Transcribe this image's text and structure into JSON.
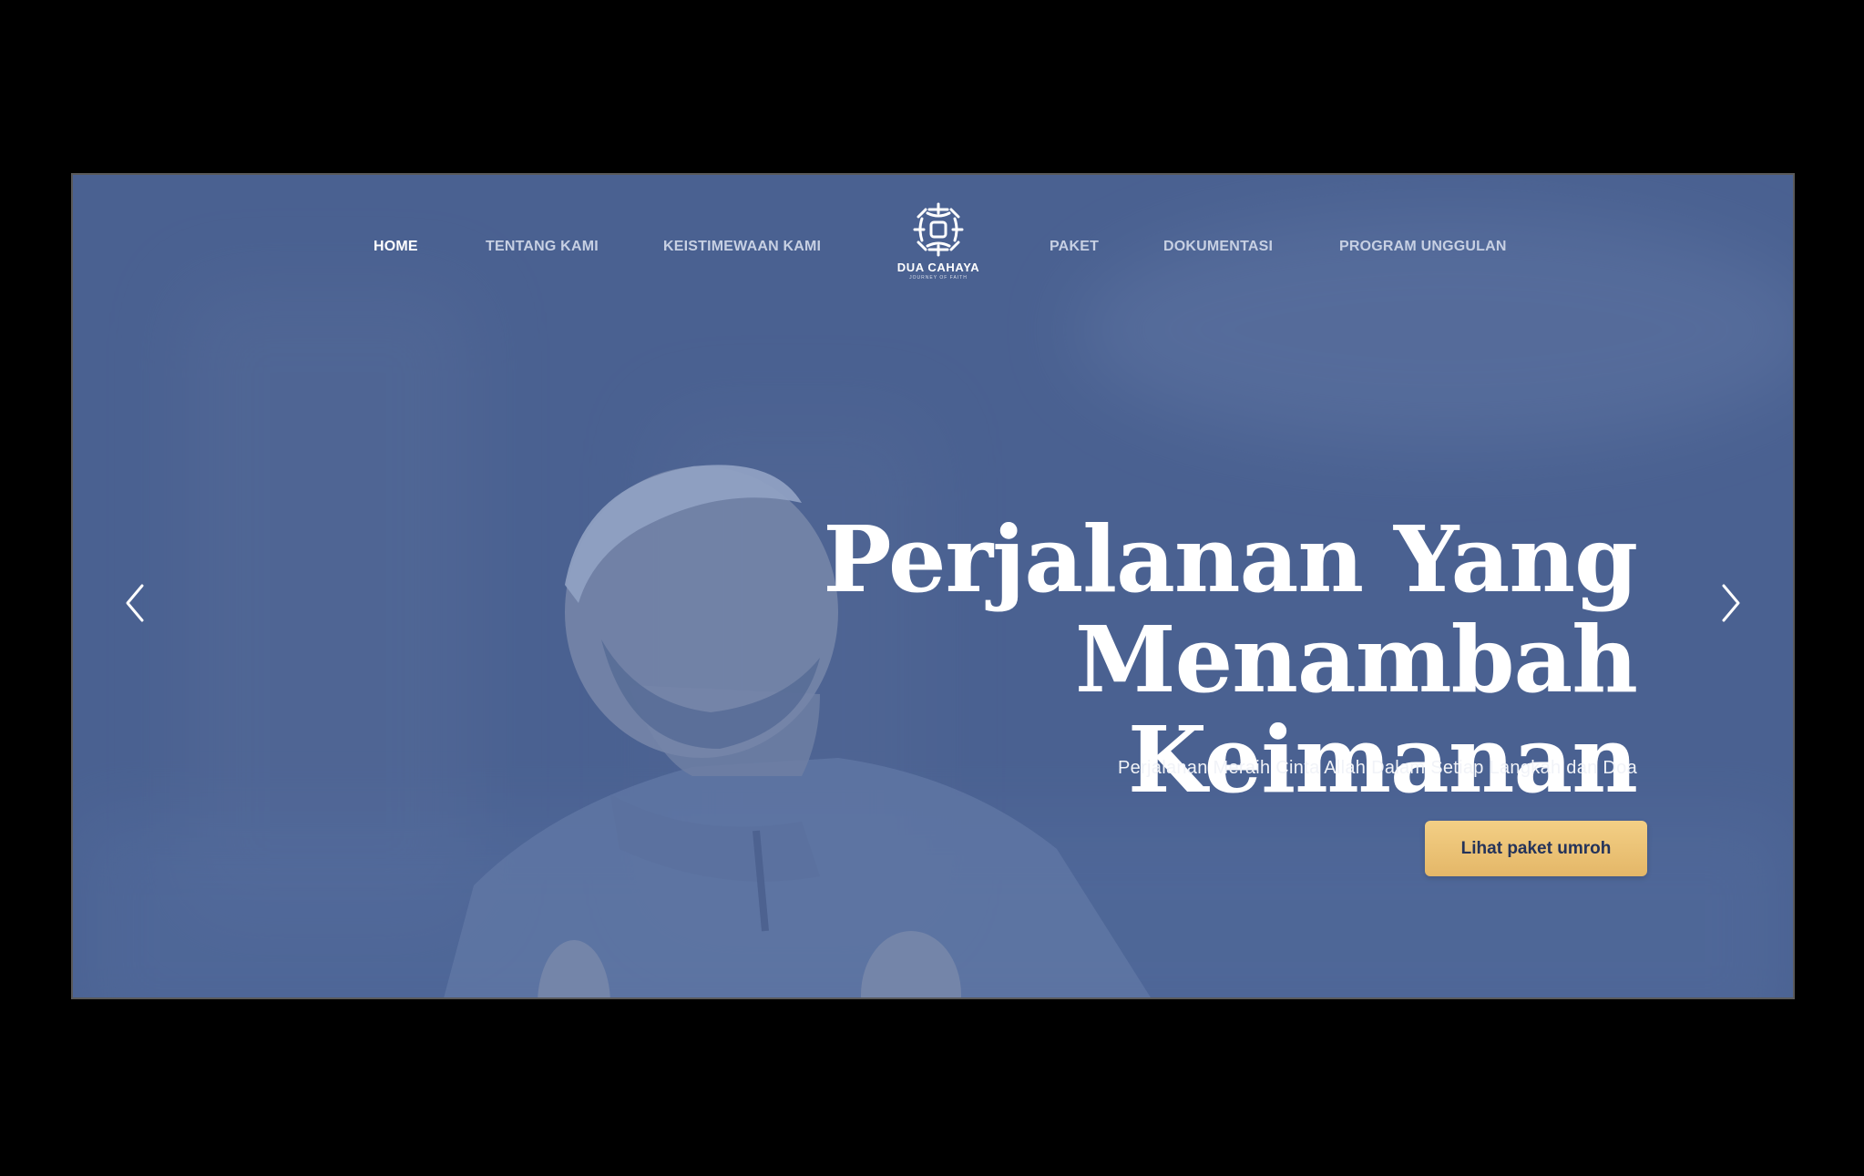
{
  "nav": {
    "left": [
      "HOME",
      "TENTANG KAMI",
      "KEISTIMEWAAN KAMI"
    ],
    "right": [
      "PAKET",
      "DOKUMENTASI",
      "PROGRAM UNGGULAN"
    ],
    "active": "HOME"
  },
  "logo": {
    "name": "DUA CAHAYA",
    "tagline": "JOURNEY OF FAITH"
  },
  "hero": {
    "title_lines": [
      "Perjalanan Yang",
      "Menambah",
      "Keimanan"
    ],
    "subtitle": "Perjalanan Meraih Cinta Allah Dalam Setiap Langkah dan Doa",
    "cta_label": "Lihat paket umroh"
  },
  "carousel": {
    "prev_icon": "chevron-left-icon",
    "next_icon": "chevron-right-icon"
  },
  "colors": {
    "overlay": "#4a6191",
    "cta": "#efc77c",
    "cta_text": "#24335a"
  }
}
